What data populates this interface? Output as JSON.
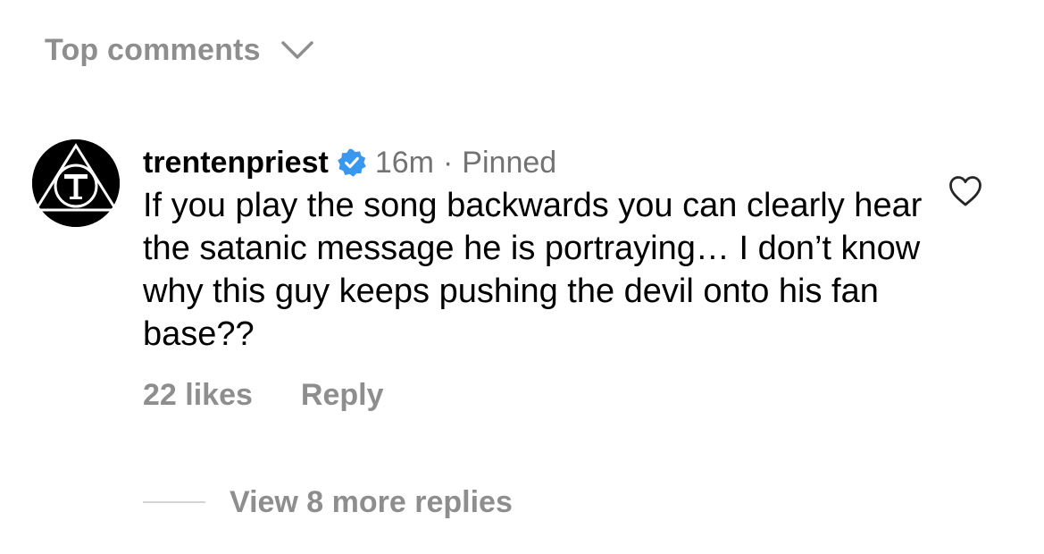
{
  "sort": {
    "label": "Top comments",
    "icon": "chevron-down-icon"
  },
  "comment": {
    "username": "trentenpriest",
    "verified_icon": "verified-badge-icon",
    "verified_color": "#3897f0",
    "time": "16m",
    "separator": "·",
    "pinned": "Pinned",
    "text": "If you play the song backwards you can clearly hear the satanic message he is portraying… I don’t know why this guy keeps pushing the devil onto his fan base??",
    "likes": "22 likes",
    "reply_label": "Reply",
    "like_icon": "heart-outline-icon"
  },
  "replies": {
    "label": "View 8 more replies"
  },
  "colors": {
    "muted_text": "#8e8e8e",
    "secondary_text": "#737373",
    "primary_text": "#000000",
    "background": "#ffffff"
  }
}
